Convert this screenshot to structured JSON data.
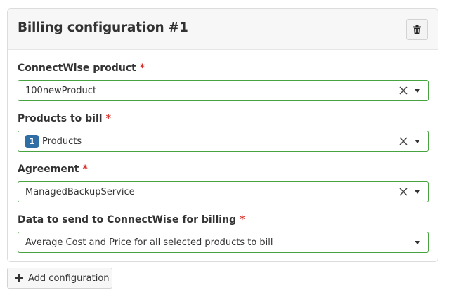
{
  "card": {
    "title": "Billing configuration #1",
    "delete_icon": "trash-icon"
  },
  "fields": [
    {
      "label": "ConnectWise product",
      "required_mark": "*",
      "value": "100newProduct",
      "clearable": true
    },
    {
      "label": "Products to bill",
      "required_mark": "*",
      "badge_count": "1",
      "value": "Products",
      "clearable": true
    },
    {
      "label": "Agreement",
      "required_mark": "*",
      "value": "ManagedBackupService",
      "clearable": true
    },
    {
      "label": "Data to send to ConnectWise for billing",
      "required_mark": "*",
      "value": "Average Cost and Price for all selected products to bill",
      "clearable": false
    }
  ],
  "add_button": {
    "label": "Add configuration",
    "icon": "plus-icon"
  },
  "colors": {
    "valid_border": "#46a33f",
    "required": "#d9312b",
    "badge": "#2f6ea5"
  }
}
